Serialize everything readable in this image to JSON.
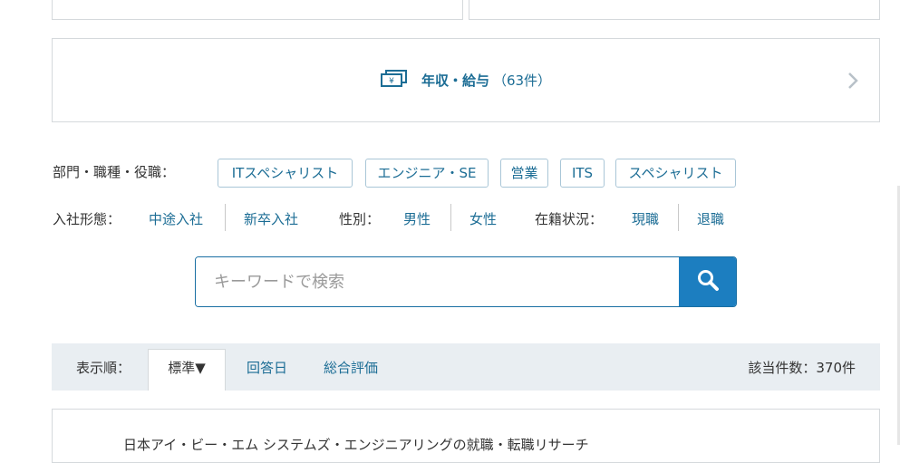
{
  "salary_card": {
    "icon": "money-icon",
    "title": "年収・給与",
    "count": "（63件）"
  },
  "filters": {
    "department": {
      "label": "部門・職種・役職：",
      "tags": [
        "ITスペシャリスト",
        "エンジニア・SE",
        "営業",
        "ITS",
        "スペシャリスト"
      ]
    },
    "join_type": {
      "label": "入社形態：",
      "options": [
        "中途入社",
        "新卒入社"
      ]
    },
    "gender": {
      "label": "性別：",
      "options": [
        "男性",
        "女性"
      ]
    },
    "status": {
      "label": "在籍状況：",
      "options": [
        "現職",
        "退職"
      ]
    }
  },
  "search": {
    "placeholder": "キーワードで検索",
    "value": "",
    "button_icon": "search-icon",
    "accent": "#1c7ec0"
  },
  "sort": {
    "label": "表示順：",
    "selected": "標準▼",
    "options": [
      "回答日",
      "総合評価"
    ],
    "result_count": "該当件数：370件"
  },
  "result": {
    "title": "日本アイ・ビー・エム システムズ・エンジニアリングの就職・転職リサーチ"
  },
  "colors": {
    "link": "#1c6d95",
    "sort_bar_bg": "#e9eef2",
    "border": "#d5d9dc"
  }
}
